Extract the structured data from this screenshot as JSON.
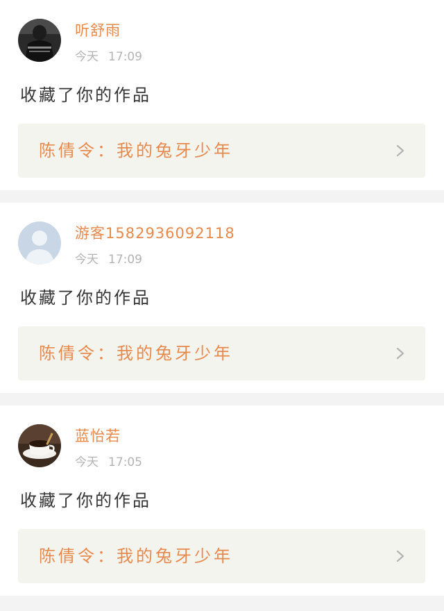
{
  "colors": {
    "accent": "#e8894c",
    "text": "#333333",
    "muted": "#b3b3b3",
    "card_link_bg": "#f4f4ef",
    "separator": "#f3f3f3"
  },
  "notifications": [
    {
      "username": "听舒雨",
      "day": "今天",
      "time": "17:09",
      "action": "收藏了你的作品",
      "work": "陈倩令：我的兔牙少年",
      "avatar": "photo-avatar-dark-person",
      "chevron": "chevron-right-icon"
    },
    {
      "username": "游客1582936092118",
      "day": "今天",
      "time": "17:09",
      "action": "收藏了你的作品",
      "work": "陈倩令：我的兔牙少年",
      "avatar": "default-user-avatar",
      "chevron": "chevron-right-icon"
    },
    {
      "username": "蓝怡若",
      "day": "今天",
      "time": "17:05",
      "action": "收藏了你的作品",
      "work": "陈倩令：我的兔牙少年",
      "avatar": "coffee-cup-avatar",
      "chevron": "chevron-right-icon"
    }
  ]
}
